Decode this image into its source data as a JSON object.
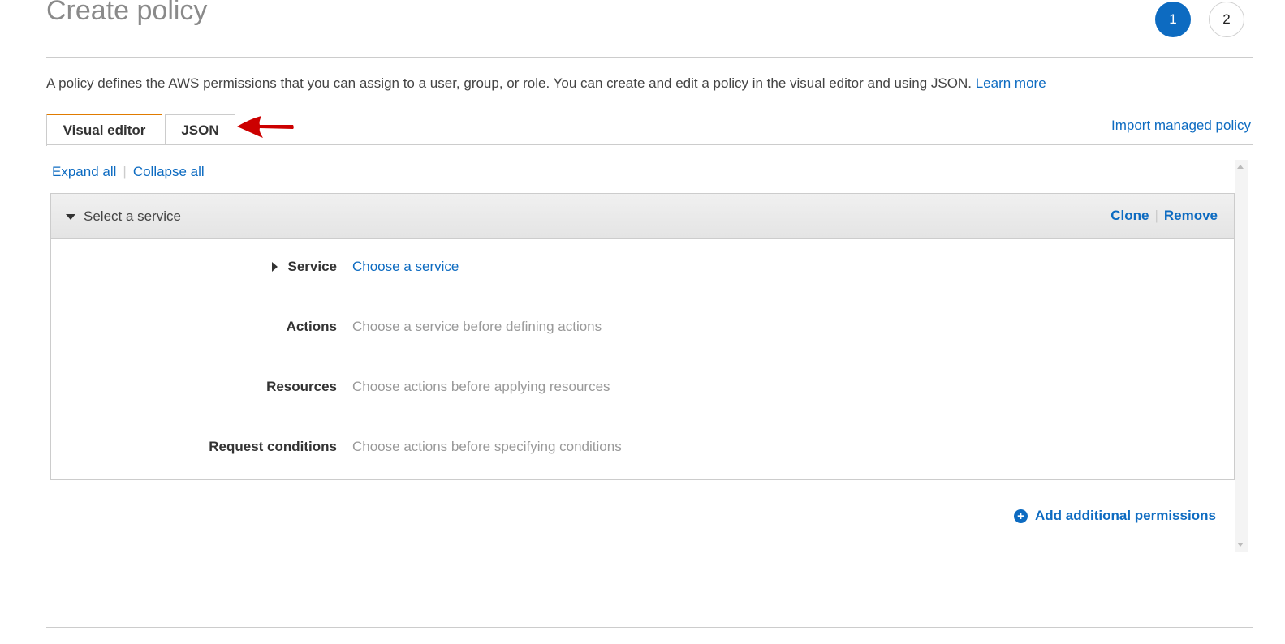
{
  "page": {
    "title": "Create policy",
    "steps": [
      "1",
      "2"
    ],
    "intro_text": "A policy defines the AWS permissions that you can assign to a user, group, or role. You can create and edit a policy in the visual editor and using JSON.",
    "learn_more": "Learn more"
  },
  "tabs": {
    "visual_editor": "Visual editor",
    "json": "JSON",
    "import_link": "Import managed policy"
  },
  "toolbar": {
    "expand_all": "Expand all",
    "collapse_all": "Collapse all"
  },
  "permission_block": {
    "header_title": "Select a service",
    "clone": "Clone",
    "remove": "Remove",
    "fields": [
      {
        "label": "Service",
        "value": "Choose a service"
      },
      {
        "label": "Actions",
        "value": "Choose a service before defining actions"
      },
      {
        "label": "Resources",
        "value": "Choose actions before applying resources"
      },
      {
        "label": "Request conditions",
        "value": "Choose actions before specifying conditions"
      }
    ]
  },
  "footer": {
    "add_permissions": "Add additional permissions"
  },
  "colors": {
    "link": "#0d6bc1",
    "active_tab_border": "#e07b00",
    "annotation_arrow": "#cc0000"
  }
}
